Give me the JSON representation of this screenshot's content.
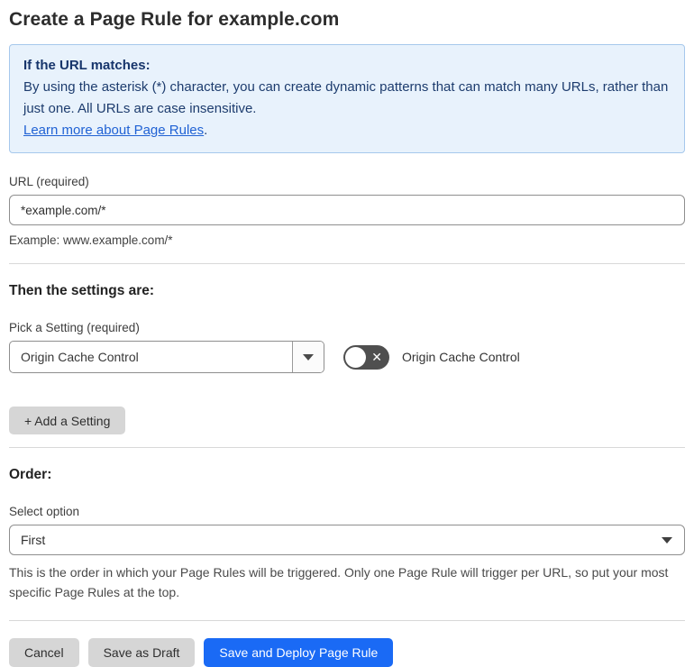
{
  "page": {
    "title": "Create a Page Rule for example.com"
  },
  "info_box": {
    "heading": "If the URL matches:",
    "body": "By using the asterisk (*) character, you can create dynamic patterns that can match many URLs, rather than just one. All URLs are case insensitive.",
    "link_text": "Learn more about Page Rules",
    "link_suffix": "."
  },
  "url_section": {
    "label": "URL (required)",
    "value": "*example.com/*",
    "example": "Example: www.example.com/*"
  },
  "settings_section": {
    "heading": "Then the settings are:",
    "picker_label": "Pick a Setting (required)",
    "picker_value": "Origin Cache Control",
    "toggle_label": "Origin Cache Control",
    "toggle_state": "off",
    "toggle_glyph": "✕",
    "add_setting_label": "+ Add a Setting"
  },
  "order_section": {
    "heading": "Order:",
    "select_label": "Select option",
    "select_value": "First",
    "help_text": "This is the order in which your Page Rules will be triggered. Only one Page Rule will trigger per URL, so put your most specific Page Rules at the top."
  },
  "footer": {
    "cancel_label": "Cancel",
    "save_draft_label": "Save as Draft",
    "save_deploy_label": "Save and Deploy Page Rule"
  },
  "colors": {
    "accent_blue": "#1a6af5",
    "info_bg": "#e8f2fc",
    "info_border": "#a6c8ec",
    "info_text": "#1d3c6e",
    "link_blue": "#2062d4",
    "toggle_off": "#4f4f4f",
    "button_gray": "#d6d6d6"
  }
}
